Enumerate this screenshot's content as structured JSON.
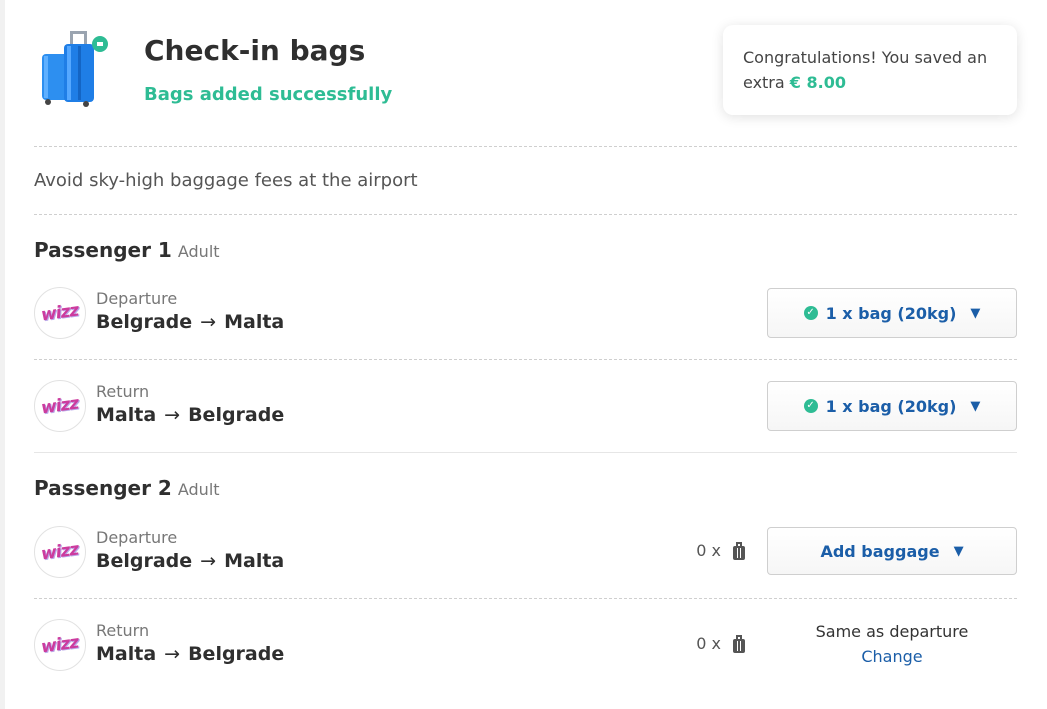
{
  "header": {
    "title": "Check-in bags",
    "subtitle": "Bags added successfully"
  },
  "promo": {
    "text": "Congratulations! You saved an extra",
    "amount": "€ 8.00"
  },
  "intro": "Avoid sky-high baggage fees at the airport",
  "airline_logo_text": "wizz",
  "colors": {
    "accent_green": "#2ebc94",
    "link_blue": "#1b5ea8"
  },
  "passengers": [
    {
      "name": "Passenger 1",
      "type": "Adult",
      "legs": [
        {
          "direction": "Departure",
          "from": "Belgrade",
          "arrow": "→",
          "to": "Malta",
          "bag_label": "1 x bag (20kg)"
        },
        {
          "direction": "Return",
          "from": "Malta",
          "arrow": "→",
          "to": "Belgrade",
          "bag_label": "1 x bag (20kg)"
        }
      ]
    },
    {
      "name": "Passenger 2",
      "type": "Adult",
      "legs": [
        {
          "direction": "Departure",
          "from": "Belgrade",
          "arrow": "→",
          "to": "Malta",
          "bag_count": "0 x",
          "bag_label": "Add baggage"
        },
        {
          "direction": "Return",
          "from": "Malta",
          "arrow": "→",
          "to": "Belgrade",
          "bag_count": "0 x",
          "same_text": "Same as departure",
          "change_label": "Change"
        }
      ]
    }
  ]
}
